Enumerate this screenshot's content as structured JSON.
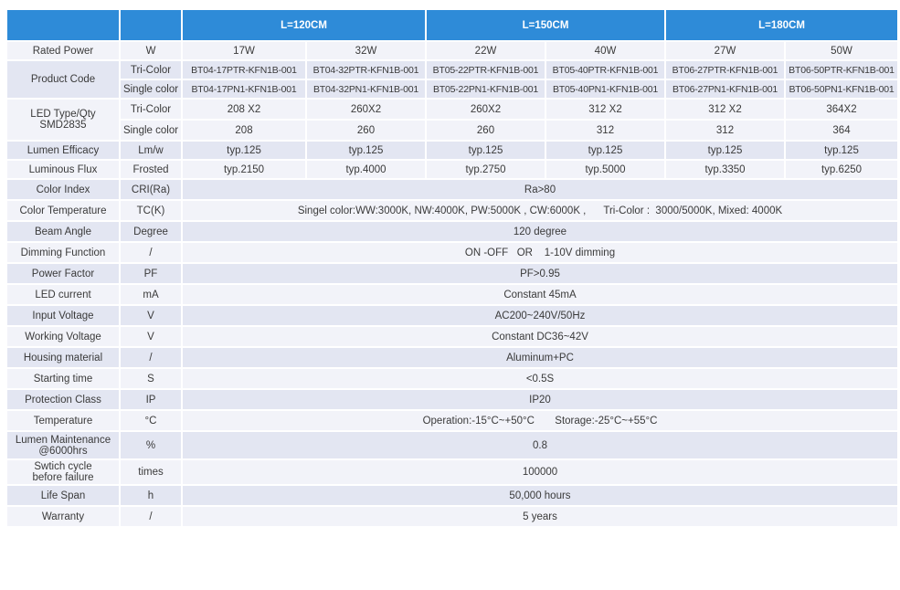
{
  "header": {
    "groups": [
      "L=120CM",
      "L=150CM",
      "L=180CM"
    ]
  },
  "rows": {
    "rated_power": {
      "label": "Rated Power",
      "unit": "W",
      "values": [
        "17W",
        "32W",
        "22W",
        "40W",
        "27W",
        "50W"
      ]
    },
    "product_code": {
      "label": "Product Code",
      "tri": {
        "sub": "Tri-Color",
        "values": [
          "BT04-17PTR-KFN1B-001",
          "BT04-32PTR-KFN1B-001",
          "BT05-22PTR-KFN1B-001",
          "BT05-40PTR-KFN1B-001",
          "BT06-27PTR-KFN1B-001",
          "BT06-50PTR-KFN1B-001"
        ]
      },
      "single": {
        "sub": "Single color",
        "values": [
          "BT04-17PN1-KFN1B-001",
          "BT04-32PN1-KFN1B-001",
          "BT05-22PN1-KFN1B-001",
          "BT05-40PN1-KFN1B-001",
          "BT06-27PN1-KFN1B-001",
          "BT06-50PN1-KFN1B-001"
        ]
      }
    },
    "led_type": {
      "label_line1": "LED Type/Qty",
      "label_line2": "SMD2835",
      "tri": {
        "sub": "Tri-Color",
        "values": [
          "208 X2",
          "260X2",
          "260X2",
          "312 X2",
          "312 X2",
          "364X2"
        ]
      },
      "single": {
        "sub": "Single color",
        "values": [
          "208",
          "260",
          "260",
          "312",
          "312",
          "364"
        ]
      }
    },
    "lumen_efficacy": {
      "label": "Lumen Efficacy",
      "unit": "Lm/w",
      "values": [
        "typ.125",
        "typ.125",
        "typ.125",
        "typ.125",
        "typ.125",
        "typ.125"
      ]
    },
    "luminous_flux": {
      "label": "Luminous Flux",
      "unit": "Frosted",
      "values": [
        "typ.2150",
        "typ.4000",
        "typ.2750",
        "typ.5000",
        "typ.3350",
        "typ.6250"
      ]
    },
    "color_index": {
      "label": "Color Index",
      "unit": "CRI(Ra)",
      "value": "Ra>80"
    },
    "color_temperature": {
      "label": "Color Temperature",
      "unit": "TC(K)",
      "value": "Singel color:WW:3000K, NW:4000K, PW:5000K , CW:6000K ,      Tri-Color :  3000/5000K, Mixed: 4000K"
    },
    "beam_angle": {
      "label": "Beam Angle",
      "unit": "Degree",
      "value": "120 degree"
    },
    "dimming_function": {
      "label": "Dimming Function",
      "unit": "/",
      "value": "ON -OFF   OR    1-10V dimming"
    },
    "power_factor": {
      "label": "Power Factor",
      "unit": "PF",
      "value": "PF>0.95"
    },
    "led_current": {
      "label": "LED current",
      "unit": "mA",
      "value": "Constant 45mA"
    },
    "input_voltage": {
      "label": "Input Voltage",
      "unit": "V",
      "value": "AC200~240V/50Hz"
    },
    "working_voltage": {
      "label": "Working Voltage",
      "unit": "V",
      "value": "Constant DC36~42V"
    },
    "housing_material": {
      "label": "Housing material",
      "unit": "/",
      "value": "Aluminum+PC"
    },
    "starting_time": {
      "label": "Starting time",
      "unit": "S",
      "value": "<0.5S"
    },
    "protection_class": {
      "label": "Protection Class",
      "unit": "IP",
      "value": "IP20"
    },
    "temperature": {
      "label": "Temperature",
      "unit": "°C",
      "value": "Operation:-15°C~+50°C       Storage:-25°C~+55°C"
    },
    "lumen_maintenance": {
      "label_line1": "Lumen Maintenance",
      "label_line2": "@6000hrs",
      "unit": "%",
      "value": "0.8"
    },
    "switch_cycle": {
      "label_line1": "Swtich cycle",
      "label_line2": "before failure",
      "unit": "times",
      "value": "100000"
    },
    "life_span": {
      "label": "Life Span",
      "unit": "h",
      "value": "50,000 hours"
    },
    "warranty": {
      "label": "Warranty",
      "unit": "/",
      "value": "5 years"
    }
  },
  "colors": {
    "header_bg": "#2e8bd8",
    "row_dark": "#e3e6f2",
    "row_light": "#f2f3f9"
  }
}
